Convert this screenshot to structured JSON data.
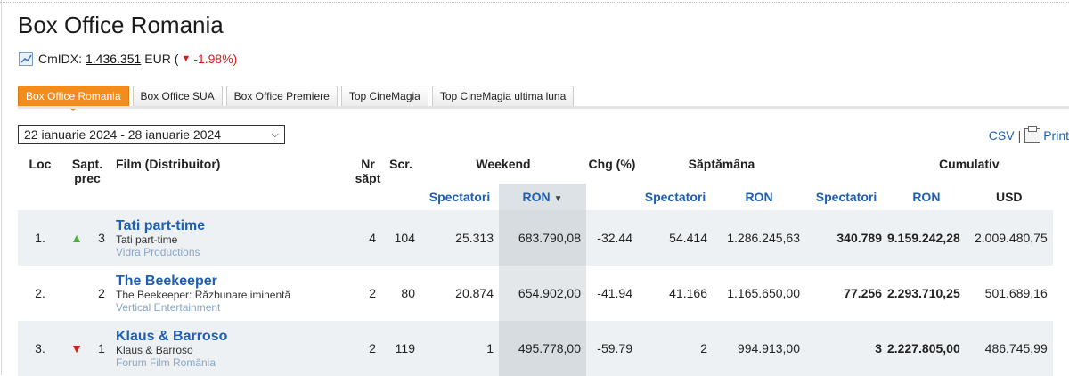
{
  "page": {
    "title": "Box Office Romania",
    "cmidx": {
      "label": "CmIDX:",
      "value": "1.436.351",
      "currency": "EUR (",
      "change": "-1.98%)"
    }
  },
  "tabs": [
    {
      "label": "Box Office Romania",
      "active": true
    },
    {
      "label": "Box Office SUA"
    },
    {
      "label": "Box Office Premiere"
    },
    {
      "label": "Top CineMagia"
    },
    {
      "label": "Top CineMagia ultima luna"
    }
  ],
  "week_select": {
    "value": "22 ianuarie 2024 - 28 ianuarie 2024"
  },
  "export": {
    "csv": "CSV",
    "sep": "|",
    "print": "Print"
  },
  "headers": {
    "loc": "Loc",
    "sapt_prec": "Sapt. prec",
    "film": "Film (Distribuitor)",
    "nr_sapt": "Nr săpt",
    "scr": "Scr.",
    "weekend": "Weekend",
    "chg": "Chg (%)",
    "saptamana": "Săptămâna",
    "cumulativ": "Cumulativ",
    "spectatori": "Spectatori",
    "ron": "RON",
    "usd": "USD"
  },
  "rows": [
    {
      "rank": "1.",
      "trend": "up",
      "prev": "3",
      "title": "Tati part-time",
      "original": "Tati part-time",
      "distributor": "Vidra Productions",
      "weeks": "4",
      "screens": "104",
      "we_spect": "25.313",
      "we_ron": "683.790,08",
      "chg": "-32.44",
      "wk_spect": "54.414",
      "wk_ron": "1.286.245,63",
      "cum_spect": "340.789",
      "cum_ron": "9.159.242,28",
      "cum_usd": "2.009.480,75"
    },
    {
      "rank": "2.",
      "trend": "none",
      "prev": "2",
      "title": "The Beekeeper",
      "original": "The Beekeeper: Răzbunare iminentă",
      "distributor": "Vertical Entertainment",
      "weeks": "2",
      "screens": "80",
      "we_spect": "20.874",
      "we_ron": "654.902,00",
      "chg": "-41.94",
      "wk_spect": "41.166",
      "wk_ron": "1.165.650,00",
      "cum_spect": "77.256",
      "cum_ron": "2.293.710,25",
      "cum_usd": "501.689,16"
    },
    {
      "rank": "3.",
      "trend": "down",
      "prev": "1",
      "title": "Klaus & Barroso",
      "original": "Klaus & Barroso",
      "distributor": "Forum Film România",
      "weeks": "2",
      "screens": "119",
      "we_spect": "1",
      "we_ron": "495.778,00",
      "chg": "-59.79",
      "wk_spect": "2",
      "wk_ron": "994.913,00",
      "cum_spect": "3",
      "cum_ron": "2.227.805,00",
      "cum_usd": "486.745,99"
    }
  ]
}
